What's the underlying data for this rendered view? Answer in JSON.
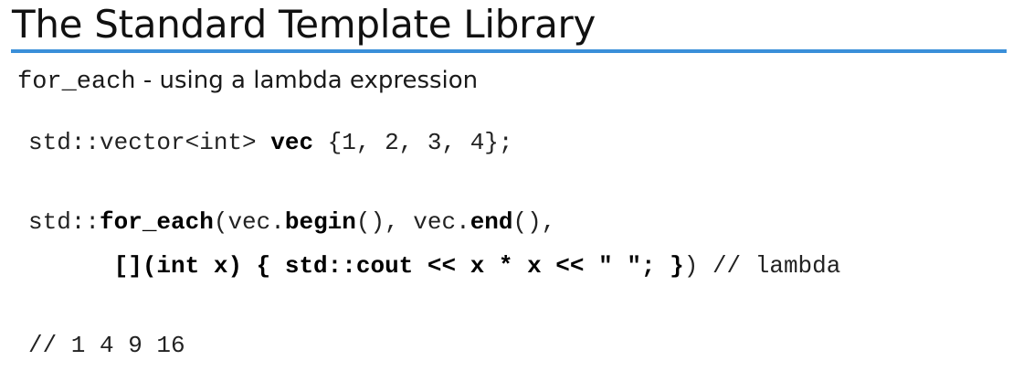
{
  "slide": {
    "title": "The Standard Template Library",
    "subtitle_code": "for_each",
    "subtitle_text": " - using a lambda expression"
  },
  "code": {
    "line1": {
      "a": "std::vector<int> ",
      "b": "vec",
      "c": " {1, 2, 3, 4};"
    },
    "line2": {
      "a": "std::",
      "b": "for_each",
      "c": "(vec.",
      "d": "begin",
      "e": "(), vec.",
      "f": "end",
      "g": "(),"
    },
    "line3": {
      "indent": "      ",
      "a": "[](int x) { std::cout << x * x << \" \"; }",
      "b": ") // lambda"
    },
    "line4": "// 1 4 9 16"
  },
  "colors": {
    "accent_rule": "#3a8fd9"
  }
}
